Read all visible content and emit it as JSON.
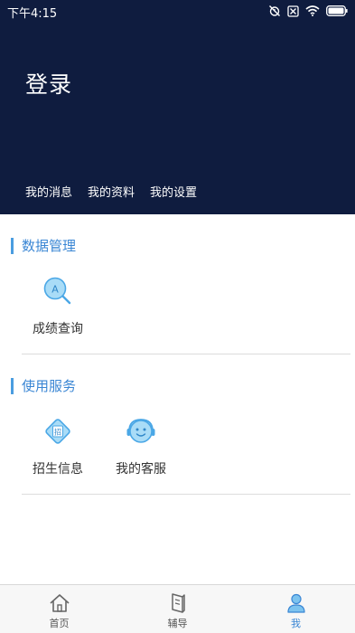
{
  "status_bar": {
    "time": "下午4:15",
    "icons": [
      "alarm-off-icon",
      "sim-off-icon",
      "wifi-icon",
      "battery-icon"
    ]
  },
  "header": {
    "login_text": "登录",
    "nav": [
      "我的消息",
      "我的资料",
      "我的设置"
    ],
    "background_color": "#0f1c3f"
  },
  "sections": [
    {
      "title": "数据管理",
      "items": [
        {
          "label": "成绩查询",
          "icon": "score-search-icon"
        }
      ]
    },
    {
      "title": "使用服务",
      "items": [
        {
          "label": "招生信息",
          "icon": "enrollment-info-icon",
          "badge": "招"
        },
        {
          "label": "我的客服",
          "icon": "customer-service-icon"
        }
      ]
    }
  ],
  "score_icon_letter": "A",
  "tabbar": {
    "tabs": [
      {
        "label": "首页",
        "icon": "home-icon"
      },
      {
        "label": "辅导",
        "icon": "book-icon"
      },
      {
        "label": "我",
        "icon": "user-icon"
      }
    ],
    "active": "我"
  },
  "accent_color": "#3a86d4"
}
